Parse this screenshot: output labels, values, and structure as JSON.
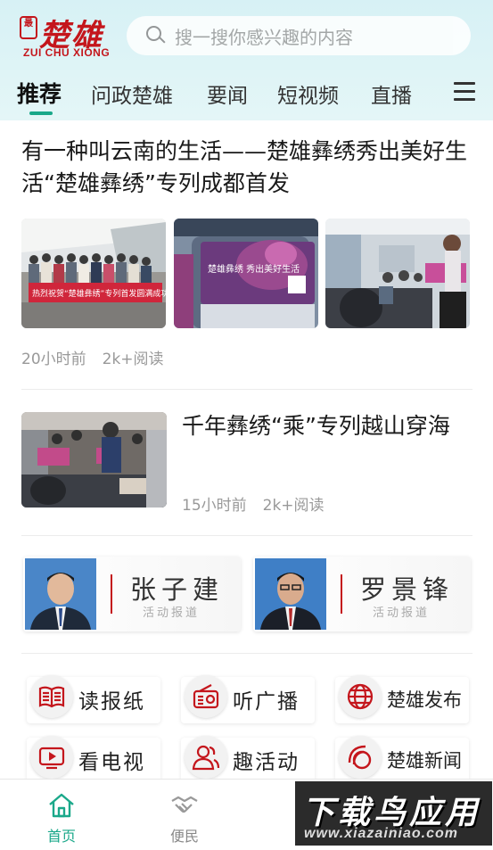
{
  "app": {
    "logo_seal": "最",
    "logo_main": "楚雄",
    "logo_sub": "ZUI CHU XIONG"
  },
  "search": {
    "placeholder": "搜一搜你感兴趣的内容"
  },
  "tabs": [
    {
      "label": "推荐",
      "active": true
    },
    {
      "label": "问政楚雄"
    },
    {
      "label": "要闻"
    },
    {
      "label": "短视频"
    },
    {
      "label": "直播"
    }
  ],
  "articles": [
    {
      "title": "有一种叫云南的生活——楚雄彝绣秀出美好生活“楚雄彝绣”专列成都首发",
      "time": "20小时前",
      "reads": "2k+阅读",
      "banner_text": "热烈祝贺“楚雄彝绣”专列首发圆满成功!",
      "poster_text": "楚雄彝绣 秀出美好生活"
    },
    {
      "title": "千年彝绣“乘”专列越山穿海",
      "time": "15小时前",
      "reads": "2k+阅读"
    }
  ],
  "leaders": [
    {
      "name": "张子建",
      "subtitle": "活动报道"
    },
    {
      "name": "罗景锋",
      "subtitle": "活动报道"
    }
  ],
  "services": [
    {
      "label": "读报纸",
      "icon": "newspaper-icon"
    },
    {
      "label": "听广播",
      "icon": "radio-icon"
    },
    {
      "label": "楚雄发布",
      "icon": "globe-icon"
    },
    {
      "label": "看电视",
      "icon": "tv-icon"
    },
    {
      "label": "趣活动",
      "icon": "people-icon"
    },
    {
      "label": "楚雄新闻",
      "icon": "news-logo-icon"
    }
  ],
  "bottom_nav": [
    {
      "label": "首页",
      "icon": "home-icon",
      "active": true
    },
    {
      "label": "便民",
      "icon": "handshake-icon"
    }
  ],
  "watermark": {
    "main": "下载鸟应用",
    "url": "www.xiazainiao.com"
  },
  "colors": {
    "accent": "#1aa88a",
    "brand_red": "#c4161c",
    "header_bg": "#d7f1f5"
  }
}
